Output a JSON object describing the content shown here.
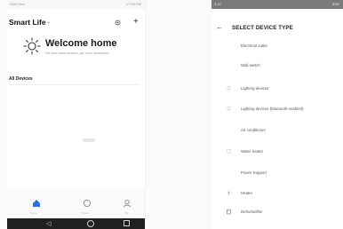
{
  "left_screen": {
    "status": {
      "left": "SMS Nos",
      "right": "17:04 PM"
    },
    "app_title": "Smart Life",
    "welcome": {
      "title": "Welcome home",
      "subtitle": "Set your home location, get more information"
    },
    "section": "All Devices",
    "bottom_nav": [
      {
        "icon": "home-icon",
        "label": "Home"
      },
      {
        "icon": "scene-icon",
        "label": "Smart"
      },
      {
        "icon": "profile-icon",
        "label": "Me"
      }
    ],
    "android_nav": [
      "back-icon",
      "home-circle-icon",
      "recent-apps-icon"
    ]
  },
  "right_screen": {
    "status": {
      "left": "3:12",
      "right": "83%"
    },
    "title": "SELECT DEVICE TYPE",
    "device_types": [
      {
        "label": "Electrical outlet",
        "icon": ""
      },
      {
        "label": "Wall switch",
        "icon": ""
      },
      {
        "label": "Lighting devices",
        "icon": "bulb-icon"
      },
      {
        "label": "Lighting devices (bluetooth enabled)",
        "icon": "bulb-icon"
      },
      {
        "label": "Air conditioner",
        "icon": ""
      },
      {
        "label": "Water heater",
        "icon": "heater-icon"
      },
      {
        "label": "Power Support",
        "icon": ""
      },
      {
        "label": "Heater",
        "icon": "heater-icon"
      },
      {
        "label": "Dehumidifier",
        "icon": "dehumidifier-icon"
      }
    ]
  },
  "colors": {
    "accent": "#2f6fde",
    "muted": "#9a9a9a"
  }
}
